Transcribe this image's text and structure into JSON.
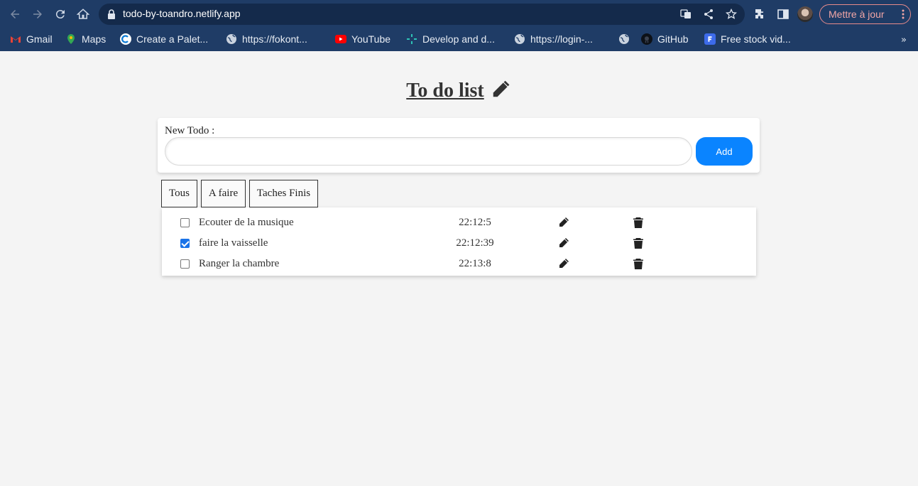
{
  "browser": {
    "url": "todo-by-toandro.netlify.app",
    "update_label": "Mettre à jour",
    "bookmarks": [
      {
        "label": "Gmail",
        "icon": "gmail-icon"
      },
      {
        "label": "Maps",
        "icon": "maps-icon"
      },
      {
        "label": "Create a Palet...",
        "icon": "palette-icon"
      },
      {
        "label": "https://fokont...",
        "icon": "globe-icon"
      },
      {
        "label": "YouTube",
        "icon": "youtube-icon"
      },
      {
        "label": "Develop and d...",
        "icon": "develop-icon"
      },
      {
        "label": "https://login-...",
        "icon": "globe-icon"
      },
      {
        "label": "",
        "icon": "globe-icon"
      },
      {
        "label": "GitHub",
        "icon": "github-icon"
      },
      {
        "label": "Free stock vid...",
        "icon": "freestock-icon"
      }
    ],
    "more_label": "»"
  },
  "app": {
    "title": "To do list",
    "form": {
      "label": "New Todo :",
      "input_value": "",
      "add_label": "Add"
    },
    "filters": [
      "Tous",
      "A faire",
      "Taches Finis"
    ],
    "todos": [
      {
        "text": "Ecouter de la musique",
        "time": "22:12:5",
        "done": false
      },
      {
        "text": "faire la vaisselle",
        "time": "22:12:39",
        "done": true
      },
      {
        "text": "Ranger la chambre",
        "time": "22:13:8",
        "done": false
      }
    ]
  },
  "colors": {
    "accent": "#0a84ff",
    "chrome": "#1f3c66",
    "background": "#f4f4f4"
  }
}
